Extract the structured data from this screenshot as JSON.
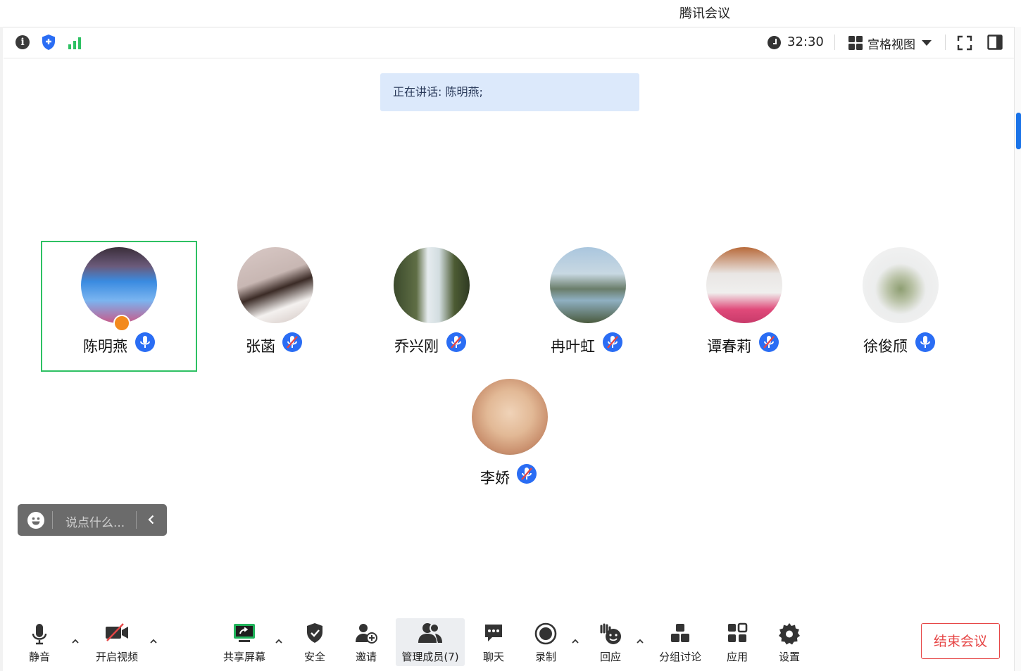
{
  "window": {
    "title": "腾讯会议"
  },
  "topbar": {
    "meeting_time": "32:30",
    "view_mode_label": "宫格视图",
    "icons": [
      "info-icon",
      "shield-icon",
      "signal-icon",
      "clock-icon",
      "grid-view-icon",
      "caret-down-icon",
      "fullscreen-icon",
      "sidebar-toggle-icon"
    ]
  },
  "speaker_banner": {
    "text": "正在讲话: 陈明燕;"
  },
  "participants": [
    {
      "name": "陈明燕",
      "muted": false,
      "active_speaker": true,
      "is_host": true
    },
    {
      "name": "张菡",
      "muted": true,
      "active_speaker": false,
      "is_host": false
    },
    {
      "name": "乔兴刚",
      "muted": true,
      "active_speaker": false,
      "is_host": false
    },
    {
      "name": "冉叶虹",
      "muted": true,
      "active_speaker": false,
      "is_host": false
    },
    {
      "name": "谭春莉",
      "muted": true,
      "active_speaker": false,
      "is_host": false
    },
    {
      "name": "徐俊颀",
      "muted": false,
      "active_speaker": false,
      "is_host": false
    },
    {
      "name": "李娇",
      "muted": true,
      "active_speaker": false,
      "is_host": false
    }
  ],
  "chat": {
    "placeholder": "说点什么..."
  },
  "bottombar": {
    "mute_label": "静音",
    "video_label": "开启视频",
    "share_label": "共享屏幕",
    "security_label": "安全",
    "invite_label": "邀请",
    "members_label": "管理成员(7)",
    "chat_label": "聊天",
    "record_label": "录制",
    "react_label": "回应",
    "breakout_label": "分组讨论",
    "apps_label": "应用",
    "settings_label": "设置",
    "end_meeting_label": "结束会议"
  },
  "colors": {
    "accent": "#2a6df4",
    "active_border": "#2ec163",
    "banner_bg": "#dce9fb",
    "end_red": "#e64545",
    "share_green": "#20b45b"
  }
}
